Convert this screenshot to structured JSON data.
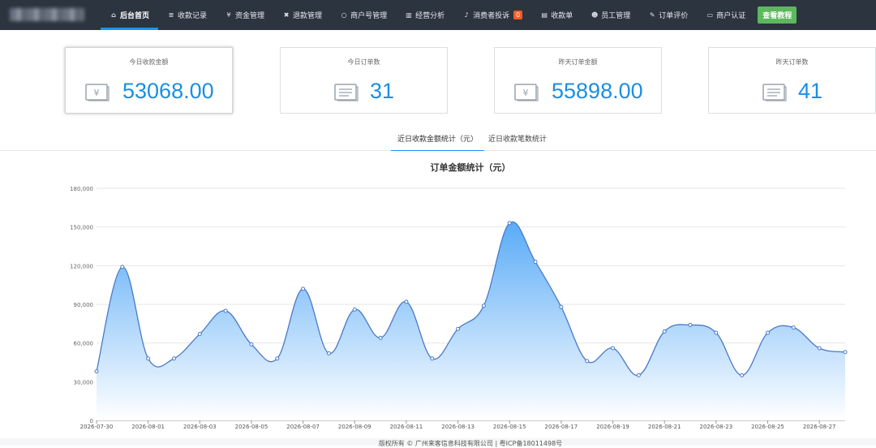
{
  "nav": {
    "items": [
      {
        "label": "后台首页",
        "icon": "home-icon",
        "glyph": "⌂",
        "active": true
      },
      {
        "label": "收款记录",
        "icon": "list-icon",
        "glyph": "≣"
      },
      {
        "label": "资金管理",
        "icon": "yen-icon",
        "glyph": "¥"
      },
      {
        "label": "退款管理",
        "icon": "close-icon",
        "glyph": "✖"
      },
      {
        "label": "商户号管理",
        "icon": "circle-icon",
        "glyph": "○"
      },
      {
        "label": "经营分析",
        "icon": "bar-chart-icon",
        "glyph": "▥"
      },
      {
        "label": "消费者投诉",
        "icon": "bell-icon",
        "glyph": "♪",
        "badge": "0"
      },
      {
        "label": "收款单",
        "icon": "document-icon",
        "glyph": "▤"
      },
      {
        "label": "员工管理",
        "icon": "users-icon",
        "glyph": "☻"
      },
      {
        "label": "订单评价",
        "icon": "edit-icon",
        "glyph": "✎"
      },
      {
        "label": "商户认证",
        "icon": "card-icon",
        "glyph": "▭"
      }
    ],
    "tutorial_button": "查看教程",
    "accent": "#1e90ff",
    "badge_color": "#ff5a1f",
    "button_color": "#5cb85c"
  },
  "stats": [
    {
      "title": "今日收款金额",
      "value": "53068.00",
      "icon": "money-icon"
    },
    {
      "title": "今日订单数",
      "value": "31",
      "icon": "receipt-icon"
    },
    {
      "title": "昨天订单金额",
      "value": "55898.00",
      "icon": "money-icon"
    },
    {
      "title": "昨天订单数",
      "value": "41",
      "icon": "receipt-icon"
    }
  ],
  "tabs": [
    {
      "label": "近日收款金额统计（元）",
      "active": true
    },
    {
      "label": "近日收款笔数统计",
      "active": false
    }
  ],
  "chart_data": {
    "type": "area",
    "title": "订单金额统计（元）",
    "ylim": [
      0,
      180000
    ],
    "yticks": [
      "0",
      "30,000",
      "60,000",
      "90,000",
      "120,000",
      "150,000",
      "180,000"
    ],
    "x": [
      "2026-07-30",
      "2026-07-31",
      "2026-08-01",
      "2026-08-02",
      "2026-08-03",
      "2026-08-04",
      "2026-08-05",
      "2026-08-06",
      "2026-08-07",
      "2026-08-08",
      "2026-08-09",
      "2026-08-10",
      "2026-08-11",
      "2026-08-12",
      "2026-08-13",
      "2026-08-14",
      "2026-08-15",
      "2026-08-16",
      "2026-08-17",
      "2026-08-18",
      "2026-08-19",
      "2026-08-20",
      "2026-08-21",
      "2026-08-22",
      "2026-08-23",
      "2026-08-24",
      "2026-08-25",
      "2026-08-26",
      "2026-08-27",
      "2026-08-28"
    ],
    "xticks": [
      "2026-07-30",
      "2026-08-01",
      "2026-08-03",
      "2026-08-05",
      "2026-08-07",
      "2026-08-09",
      "2026-08-11",
      "2026-08-13",
      "2026-08-15",
      "2026-08-17",
      "2026-08-19",
      "2026-08-21",
      "2026-08-23",
      "2026-08-25",
      "2026-08-27"
    ],
    "values": [
      38000,
      119000,
      48000,
      48000,
      67000,
      85000,
      59000,
      48000,
      102000,
      52000,
      86000,
      64000,
      92000,
      48000,
      71000,
      89000,
      153000,
      123000,
      88000,
      46000,
      56000,
      35000,
      69000,
      74000,
      68000,
      35000,
      68000,
      72000,
      56000,
      53000
    ],
    "grid": true,
    "line_color": "#4a79c8",
    "fill_top": "#5aabf7",
    "fill_bottom": "#ffffff"
  },
  "footer": {
    "text": "版权所有 © 广州来客信息科技有限公司 | 粤ICP备18011498号"
  }
}
